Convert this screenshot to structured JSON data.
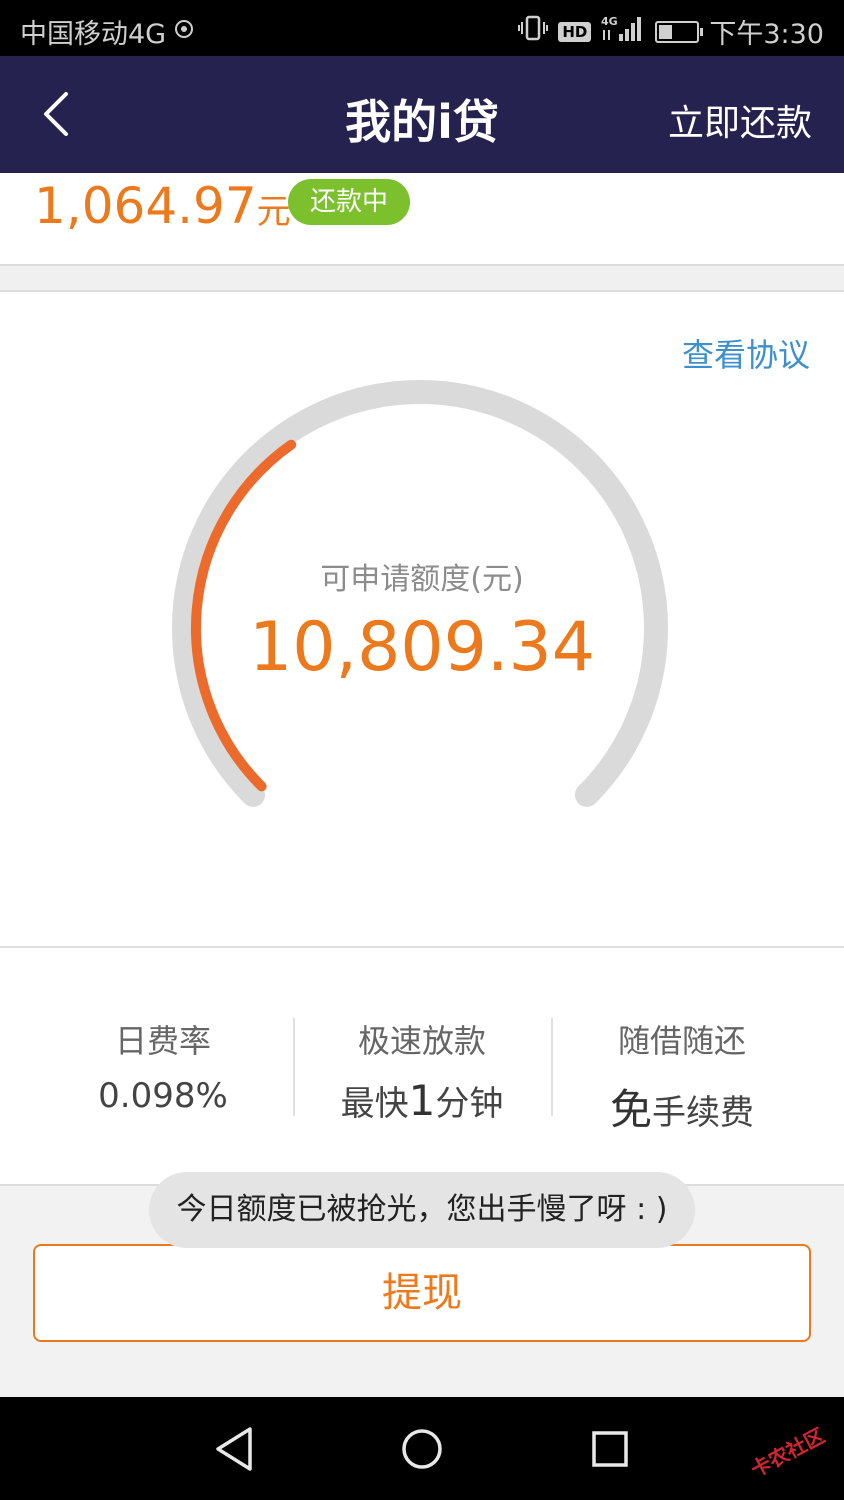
{
  "status_bar": {
    "carrier": "中国移动4G",
    "hd": "HD",
    "network": "4G",
    "time": "下午3:30",
    "battery_level": 0.35
  },
  "header": {
    "title": "我的i贷",
    "action_label": "立即还款"
  },
  "loan": {
    "amount": "1,064.97",
    "unit": "元",
    "status_badge": "还款中"
  },
  "quota_card": {
    "agreement_link": "查看协议",
    "label": "可申请额度(元)",
    "value": "10,809.34",
    "progress": 0.37
  },
  "features": [
    {
      "title": "日费率",
      "value": "0.098%"
    },
    {
      "title": "极速放款",
      "value_prefix": "最快",
      "value_emphasis": "1",
      "value_suffix": "分钟"
    },
    {
      "title": "随借随还",
      "value_emphasis": "免",
      "value_suffix": "手续费"
    }
  ],
  "toast": "今日额度已被抢光，您出手慢了呀 : )",
  "withdraw_button": "提现",
  "watermark": "卡农社区",
  "colors": {
    "header_bg": "#26224f",
    "accent": "#ec7a1c",
    "badge_green": "#7cc12d",
    "link_blue": "#3d8fce"
  }
}
